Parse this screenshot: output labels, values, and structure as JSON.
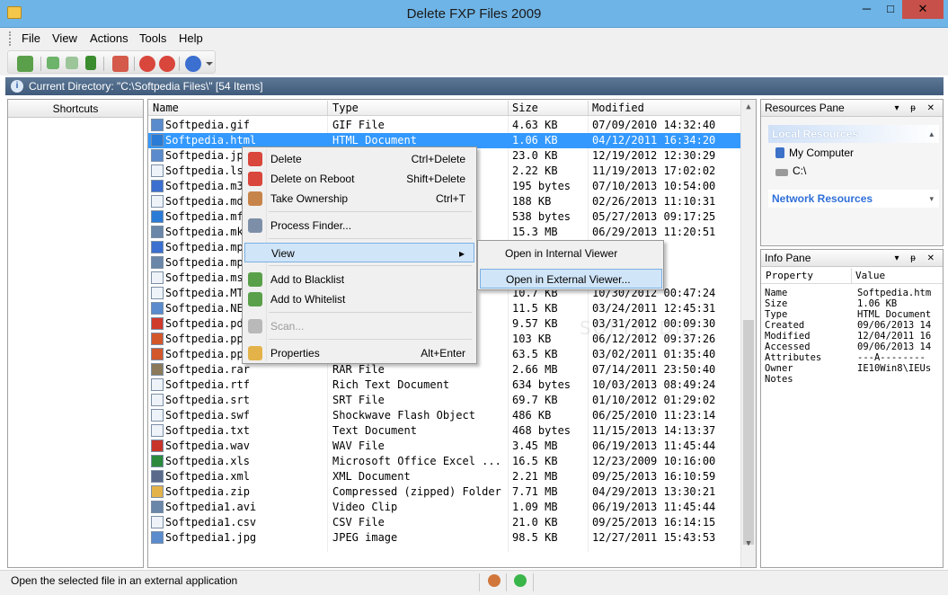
{
  "window": {
    "title": "Delete FXP Files 2009",
    "minimize": "─",
    "maximize": "□",
    "close": "✕"
  },
  "menu": [
    "File",
    "View",
    "Actions",
    "Tools",
    "Help"
  ],
  "current_directory": "Current Directory: \"C:\\Softpedia Files\\\" [54 Items]",
  "shortcuts": {
    "header": "Shortcuts"
  },
  "filelist": {
    "columns": [
      "Name",
      "Type",
      "Size",
      "Modified"
    ],
    "rows": [
      {
        "name": "Softpedia.gif",
        "type": "GIF File",
        "size": "4.63 KB",
        "modified": "07/09/2010 14:32:40",
        "icon": "image-icon"
      },
      {
        "name": "Softpedia.html",
        "type": "HTML Document",
        "size": "1.06 KB",
        "modified": "04/12/2011 16:34:20",
        "icon": "ie-icon",
        "selected": true
      },
      {
        "name": "Softpedia.jp",
        "type": "",
        "size": "23.0 KB",
        "modified": "12/19/2012 12:30:29",
        "icon": "image-icon"
      },
      {
        "name": "Softpedia.ls",
        "type": "",
        "size": "2.22 KB",
        "modified": "11/19/2013 17:02:02",
        "icon": "doc-icon"
      },
      {
        "name": "Softpedia.m3",
        "type": "",
        "size": "195 bytes",
        "modified": "07/10/2013 10:54:00",
        "icon": "music-icon"
      },
      {
        "name": "Softpedia.md",
        "type": "",
        "size": "188 KB",
        "modified": "02/26/2013 11:10:31",
        "icon": "doc-icon"
      },
      {
        "name": "Softpedia.mf",
        "type": "",
        "size": "538 bytes",
        "modified": "05/27/2013 09:17:25",
        "icon": "ie-icon"
      },
      {
        "name": "Softpedia.mk",
        "type": "",
        "size": "15.3 MB",
        "modified": "06/29/2013 11:20:51",
        "icon": "video-icon"
      },
      {
        "name": "Softpedia.mp",
        "type": "",
        "size": "",
        "modified": "10:50:54",
        "icon": "music-icon"
      },
      {
        "name": "Softpedia.mp",
        "type": "",
        "size": "",
        "modified": "08:35:38",
        "icon": "video-icon"
      },
      {
        "name": "Softpedia.ms",
        "type": "",
        "size": "",
        "modified": "15:02:09",
        "icon": "doc-icon"
      },
      {
        "name": "Softpedia.MT",
        "type": "",
        "size": "10.7 KB",
        "modified": "10/30/2012 00:47:24",
        "icon": "doc-icon"
      },
      {
        "name": "Softpedia.NE",
        "type": "",
        "size": "11.5 KB",
        "modified": "03/24/2011 12:45:31",
        "icon": "image-icon"
      },
      {
        "name": "Softpedia.pd",
        "type": "",
        "size": "9.57 KB",
        "modified": "03/31/2012 00:09:30",
        "icon": "pdf-icon"
      },
      {
        "name": "Softpedia.pp",
        "type": "...",
        "size": "103 KB",
        "modified": "06/12/2012 09:37:26",
        "icon": "ppt-icon"
      },
      {
        "name": "Softpedia.pp",
        "type": "...",
        "size": "63.5 KB",
        "modified": "03/02/2011 01:35:40",
        "icon": "ppt-icon"
      },
      {
        "name": "Softpedia.rar",
        "type": "RAR File",
        "size": "2.66 MB",
        "modified": "07/14/2011 23:50:40",
        "icon": "archive-icon"
      },
      {
        "name": "Softpedia.rtf",
        "type": "Rich Text Document",
        "size": "634 bytes",
        "modified": "10/03/2013 08:49:24",
        "icon": "doc-icon"
      },
      {
        "name": "Softpedia.srt",
        "type": "SRT File",
        "size": "69.7 KB",
        "modified": "01/10/2012 01:29:02",
        "icon": "doc-icon"
      },
      {
        "name": "Softpedia.swf",
        "type": "Shockwave Flash Object",
        "size": "486 KB",
        "modified": "06/25/2010 11:23:14",
        "icon": "doc-icon"
      },
      {
        "name": "Softpedia.txt",
        "type": "Text Document",
        "size": "468 bytes",
        "modified": "11/15/2013 14:13:37",
        "icon": "doc-icon"
      },
      {
        "name": "Softpedia.wav",
        "type": "WAV File",
        "size": "3.45 MB",
        "modified": "06/19/2013 11:45:44",
        "icon": "audio-icon"
      },
      {
        "name": "Softpedia.xls",
        "type": "Microsoft Office Excel ...",
        "size": "16.5 KB",
        "modified": "12/23/2009 10:16:00",
        "icon": "excel-icon"
      },
      {
        "name": "Softpedia.xml",
        "type": "XML Document",
        "size": "2.21 MB",
        "modified": "09/25/2013 16:10:59",
        "icon": "xml-icon"
      },
      {
        "name": "Softpedia.zip",
        "type": "Compressed (zipped) Folder",
        "size": "7.71 MB",
        "modified": "04/29/2013 13:30:21",
        "icon": "zip-icon"
      },
      {
        "name": "Softpedia1.avi",
        "type": "Video Clip",
        "size": "1.09 MB",
        "modified": "06/19/2013 11:45:44",
        "icon": "video-icon"
      },
      {
        "name": "Softpedia1.csv",
        "type": "CSV File",
        "size": "21.0 KB",
        "modified": "09/25/2013 16:14:15",
        "icon": "doc-icon"
      },
      {
        "name": "Softpedia1.jpg",
        "type": "JPEG image",
        "size": "98.5 KB",
        "modified": "12/27/2011 15:43:53",
        "icon": "image-icon"
      }
    ]
  },
  "context_menu": {
    "items": [
      {
        "label": "Delete",
        "shortcut": "Ctrl+Delete",
        "icon": "delete-icon"
      },
      {
        "label": "Delete on Reboot",
        "shortcut": "Shift+Delete",
        "icon": "delete-reboot-icon"
      },
      {
        "label": "Take Ownership",
        "shortcut": "Ctrl+T",
        "icon": "ownership-icon"
      },
      {
        "label": "Process Finder...",
        "shortcut": "",
        "icon": "process-finder-icon"
      },
      {
        "label": "View",
        "shortcut": "",
        "icon": ""
      },
      {
        "label": "Add to Blacklist",
        "shortcut": "",
        "icon": "blacklist-icon"
      },
      {
        "label": "Add to Whitelist",
        "shortcut": "",
        "icon": "whitelist-icon"
      },
      {
        "label": "Scan...",
        "shortcut": "",
        "icon": "scan-icon",
        "disabled": true
      },
      {
        "label": "Properties",
        "shortcut": "Alt+Enter",
        "icon": "properties-icon"
      }
    ],
    "submenu_arrow": "▸",
    "submenu": [
      "Open in Internal Viewer",
      "Open in External Viewer..."
    ]
  },
  "resources_pane": {
    "title": "Resources Pane",
    "local_header": "Local Resources",
    "local_items": [
      "My Computer",
      "C:\\"
    ],
    "network_header": "Network Resources"
  },
  "info_pane": {
    "title": "Info Pane",
    "columns": [
      "Property",
      "Value"
    ],
    "rows": [
      {
        "k": "Name",
        "v": "Softpedia.htm"
      },
      {
        "k": "Size",
        "v": "1.06 KB"
      },
      {
        "k": "Type",
        "v": "HTML Document"
      },
      {
        "k": "Created",
        "v": "09/06/2013 14"
      },
      {
        "k": "Modified",
        "v": "12/04/2011 16"
      },
      {
        "k": "Accessed",
        "v": "09/06/2013 14"
      },
      {
        "k": "Attributes",
        "v": "---A--------"
      },
      {
        "k": "Owner",
        "v": "IE10Win8\\IEUs"
      },
      {
        "k": "Notes",
        "v": ""
      }
    ]
  },
  "pane_buttons": "▾ ᵽ ✕",
  "status": {
    "text": "Open the selected file in an external application"
  },
  "watermark": "SOFTPEDIA",
  "colors": {
    "titlebar": "#6fb4e6",
    "selection": "#3399ff",
    "close": "#c7504a",
    "curdir": "#4c6786",
    "menu_highlight": "#d1e5f8"
  }
}
